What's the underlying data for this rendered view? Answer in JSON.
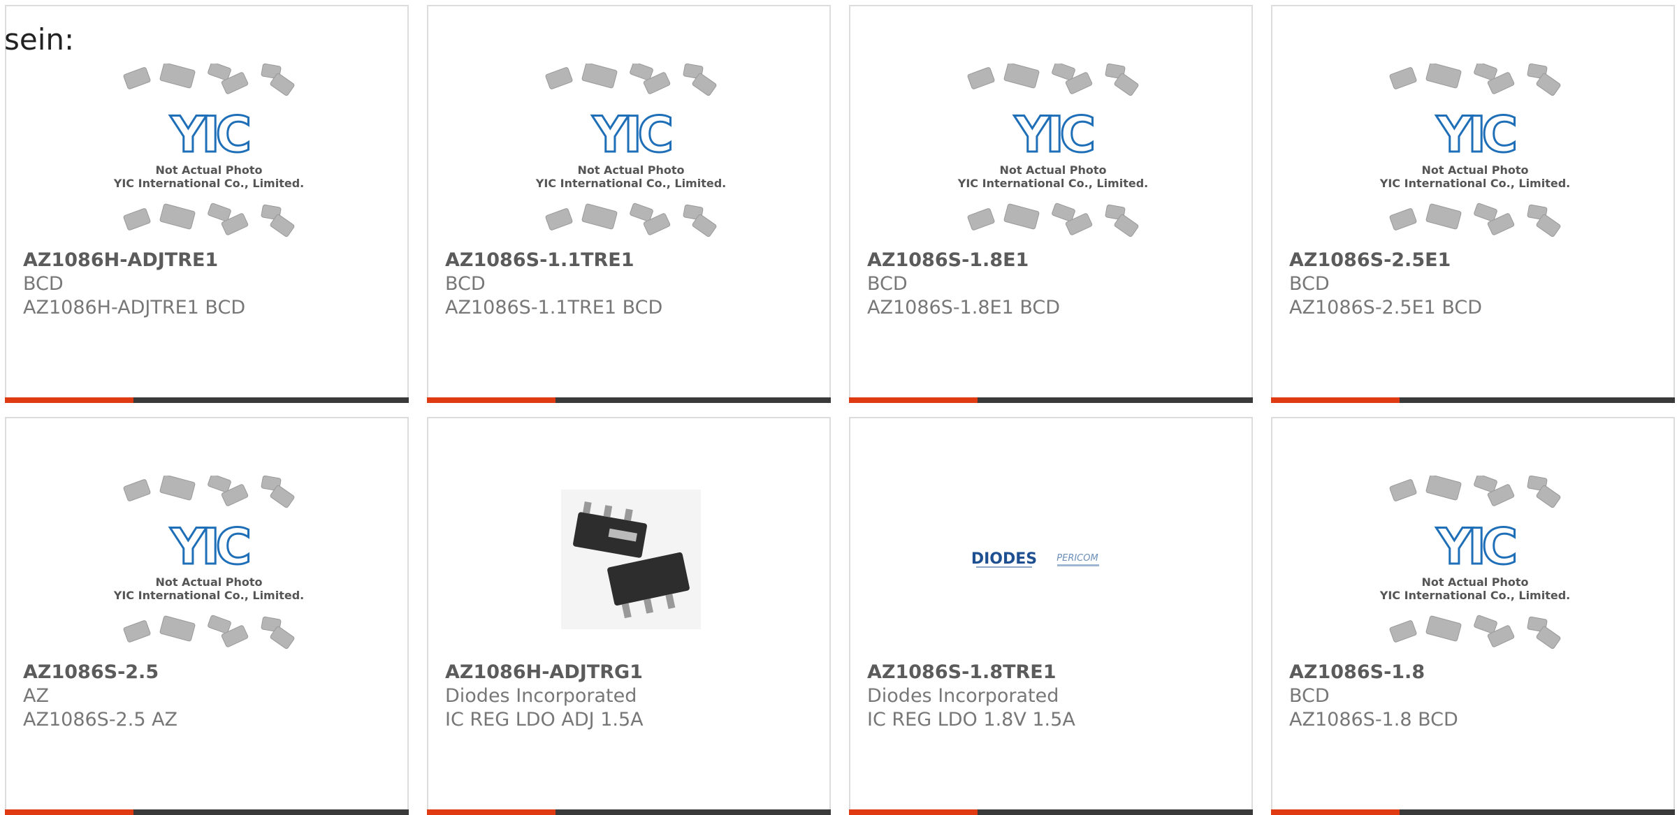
{
  "lead_text": "sein:",
  "accent_color": "#e03a12",
  "bar_color": "#3a3a3a",
  "placeholder": {
    "line1": "Not Actual Photo",
    "line2": "YIC International Co., Limited.",
    "logo_text": "YIC"
  },
  "diodes_logo": {
    "brand": "DIODES",
    "sub": "PERICOM"
  },
  "products": [
    {
      "part": "AZ1086H-ADJTRE1",
      "mfr": "BCD",
      "desc": "AZ1086H-ADJTRE1 BCD",
      "image": "yic-placeholder"
    },
    {
      "part": "AZ1086S-1.1TRE1",
      "mfr": "BCD",
      "desc": "AZ1086S-1.1TRE1 BCD",
      "image": "yic-placeholder"
    },
    {
      "part": "AZ1086S-1.8E1",
      "mfr": "BCD",
      "desc": "AZ1086S-1.8E1 BCD",
      "image": "yic-placeholder"
    },
    {
      "part": "AZ1086S-2.5E1",
      "mfr": "BCD",
      "desc": "AZ1086S-2.5E1 BCD",
      "image": "yic-placeholder"
    },
    {
      "part": "AZ1086S-2.5",
      "mfr": "AZ",
      "desc": "AZ1086S-2.5 AZ",
      "image": "yic-placeholder"
    },
    {
      "part": "AZ1086H-ADJTRG1",
      "mfr": "Diodes Incorporated",
      "desc": "IC REG LDO ADJ 1.5A",
      "image": "sot223-chip"
    },
    {
      "part": "AZ1086S-1.8TRE1",
      "mfr": "Diodes Incorporated",
      "desc": "IC REG LDO 1.8V 1.5A",
      "image": "diodes-logo"
    },
    {
      "part": "AZ1086S-1.8",
      "mfr": "BCD",
      "desc": "AZ1086S-1.8 BCD",
      "image": "yic-placeholder"
    }
  ]
}
